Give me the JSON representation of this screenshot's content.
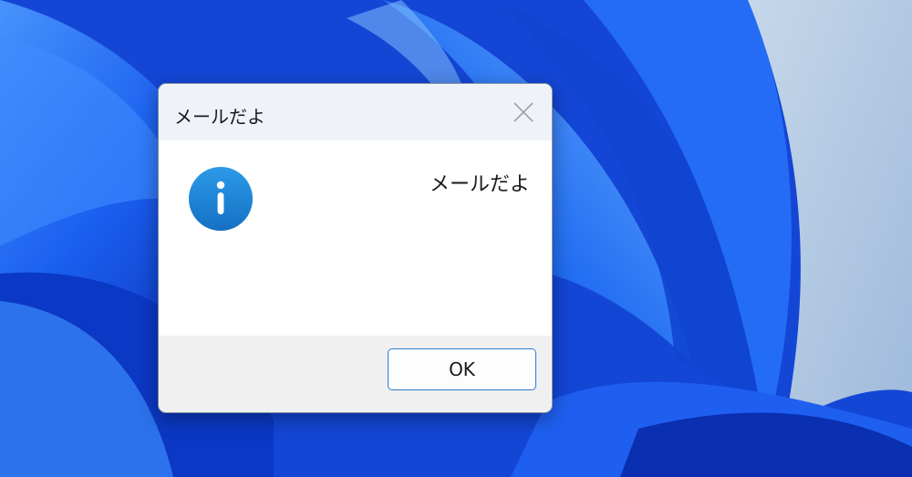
{
  "dialog": {
    "title": "メールだよ",
    "message": "メールだよ",
    "ok_label": "OK"
  },
  "icons": {
    "dialog_icon": "info-icon",
    "close": "close-icon"
  },
  "colors": {
    "accent": "#2a7ccf",
    "info_icon": "#1e88d8",
    "titlebar": "#eff3f9",
    "footer": "#f0f0f0"
  }
}
